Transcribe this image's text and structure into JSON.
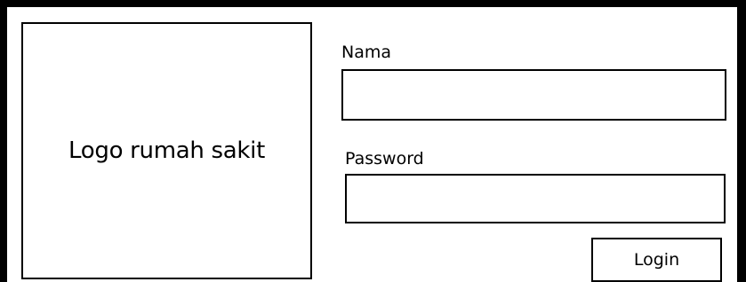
{
  "logo": {
    "text": "Logo rumah sakit"
  },
  "form": {
    "nama_label": "Nama",
    "nama_value": "",
    "password_label": "Password",
    "password_value": "",
    "login_label": "Login"
  }
}
